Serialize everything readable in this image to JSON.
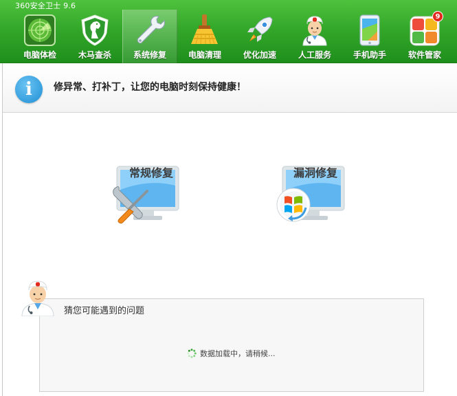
{
  "app": {
    "title": "360安全卫士 9.6"
  },
  "nav": {
    "items": [
      {
        "label": "电脑体检",
        "icon": "radar-icon"
      },
      {
        "label": "木马查杀",
        "icon": "horse-shield-icon"
      },
      {
        "label": "系统修复",
        "icon": "wrench-icon",
        "active": true
      },
      {
        "label": "电脑清理",
        "icon": "broom-icon"
      },
      {
        "label": "优化加速",
        "icon": "rocket-icon"
      },
      {
        "label": "人工服务",
        "icon": "doctor-icon"
      },
      {
        "label": "手机助手",
        "icon": "phone-icon"
      },
      {
        "label": "软件管家",
        "icon": "app-store-icon",
        "badge": "9"
      }
    ]
  },
  "banner": {
    "icon": "info-icon",
    "text": "修异常、打补丁，让您的电脑时刻保持健康！"
  },
  "options": {
    "regular_repair": "常规修复",
    "vulnerability_repair": "漏洞修复"
  },
  "faq": {
    "title": "猜您可能遇到的问题",
    "loading_text": "数据加载中，请稍候..."
  },
  "colors": {
    "toolbar_green": "#34a82a",
    "info_blue": "#1f8fd4",
    "badge_red": "#e02b1e"
  }
}
